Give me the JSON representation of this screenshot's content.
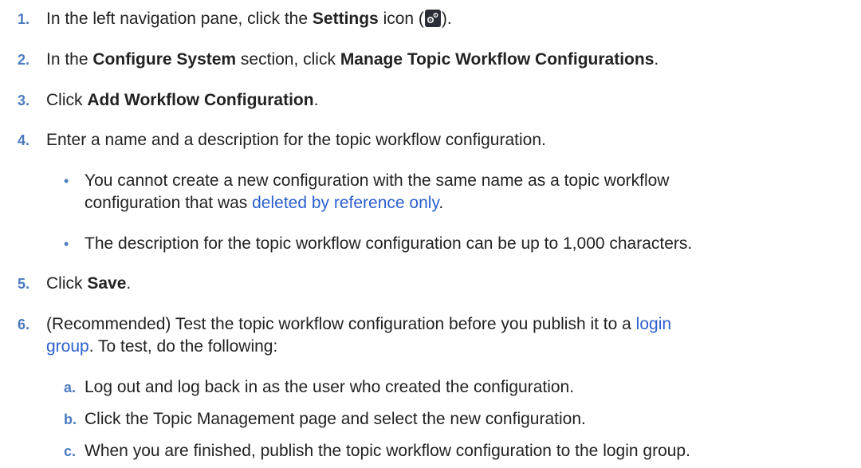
{
  "steps": [
    {
      "num": "1.",
      "pre": "In the left navigation pane, click the ",
      "bold": "Settings",
      "post": " icon (",
      "icon": "settings-gear-icon",
      "end": ")."
    },
    {
      "num": "2.",
      "pre": "In the ",
      "bold1": "Configure System",
      "mid": " section, click ",
      "bold2": "Manage Topic Workflow Configurations",
      "post": "."
    },
    {
      "num": "3.",
      "pre": "Click ",
      "bold": "Add Workflow Configuration",
      "post": "."
    },
    {
      "num": "4.",
      "text": "Enter a name and a description for the topic workflow configuration."
    },
    {
      "num": "5.",
      "pre": "Click ",
      "bold": "Save",
      "post": "."
    },
    {
      "num": "6.",
      "line1_pre": "(Recommended) Test the topic workflow configuration before you publish it to a ",
      "link1": "login",
      "link2": "group",
      "line2_post": ". To test, do the following:"
    }
  ],
  "bullets": [
    {
      "line1": "You cannot create a new configuration with the same name as a topic workflow",
      "line2_pre": "configuration that was ",
      "link": "deleted by reference only",
      "line2_post": "."
    },
    {
      "text": "The description for the topic workflow configuration can be up to 1,000 characters."
    }
  ],
  "substeps": [
    {
      "letter": "a.",
      "text": "Log out and log back in as the user who created the configuration."
    },
    {
      "letter": "b.",
      "text": "Click the Topic Management page and select the new configuration."
    },
    {
      "letter": "c.",
      "text": "When you are finished, publish the topic workflow configuration to the login group."
    }
  ],
  "bullet_glyph": "•"
}
